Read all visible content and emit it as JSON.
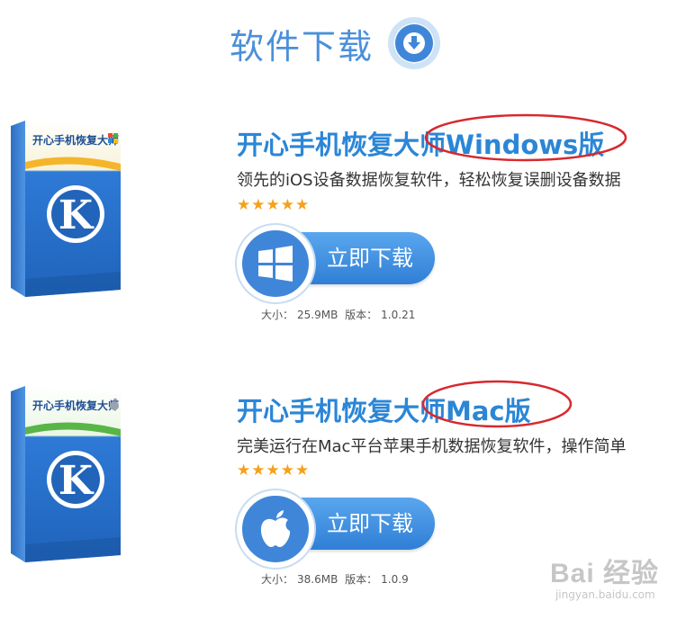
{
  "header": {
    "title": "软件下载",
    "icon": "download-circle-icon"
  },
  "products": [
    {
      "box_brand": "开心手机恢复大师",
      "box_letter": "K",
      "title": "开心手机恢复大师Windows版",
      "description": "领先的iOS设备数据恢复软件，轻松恢复误删设备数据",
      "stars": "★★★★★",
      "rating": 5,
      "platform_icon": "windows-logo-icon",
      "button_label": "立即下载",
      "size_label": "大小：",
      "size_value": "25.9MB",
      "version_label": "版本：",
      "version_value": "1.0.21",
      "accent": "#f5b52a"
    },
    {
      "box_brand": "开心手机恢复大师",
      "box_letter": "K",
      "title": "开心手机恢复大师Mac版",
      "description": "完美运行在Mac平台苹果手机数据恢复软件，操作简单",
      "stars": "★★★★★",
      "rating": 5,
      "platform_icon": "apple-logo-icon",
      "button_label": "立即下载",
      "size_label": "大小：",
      "size_value": "38.6MB",
      "version_label": "版本：",
      "version_value": "1.0.9",
      "accent": "#59b548"
    }
  ],
  "watermark": {
    "main": "Bai 经验",
    "sub": "jingyan.baidu.com"
  },
  "colors": {
    "title_blue": "#2b86d6",
    "button_blue": "#3f86d8",
    "star_orange": "#f5a11b",
    "annotation_red": "#d8282e"
  }
}
